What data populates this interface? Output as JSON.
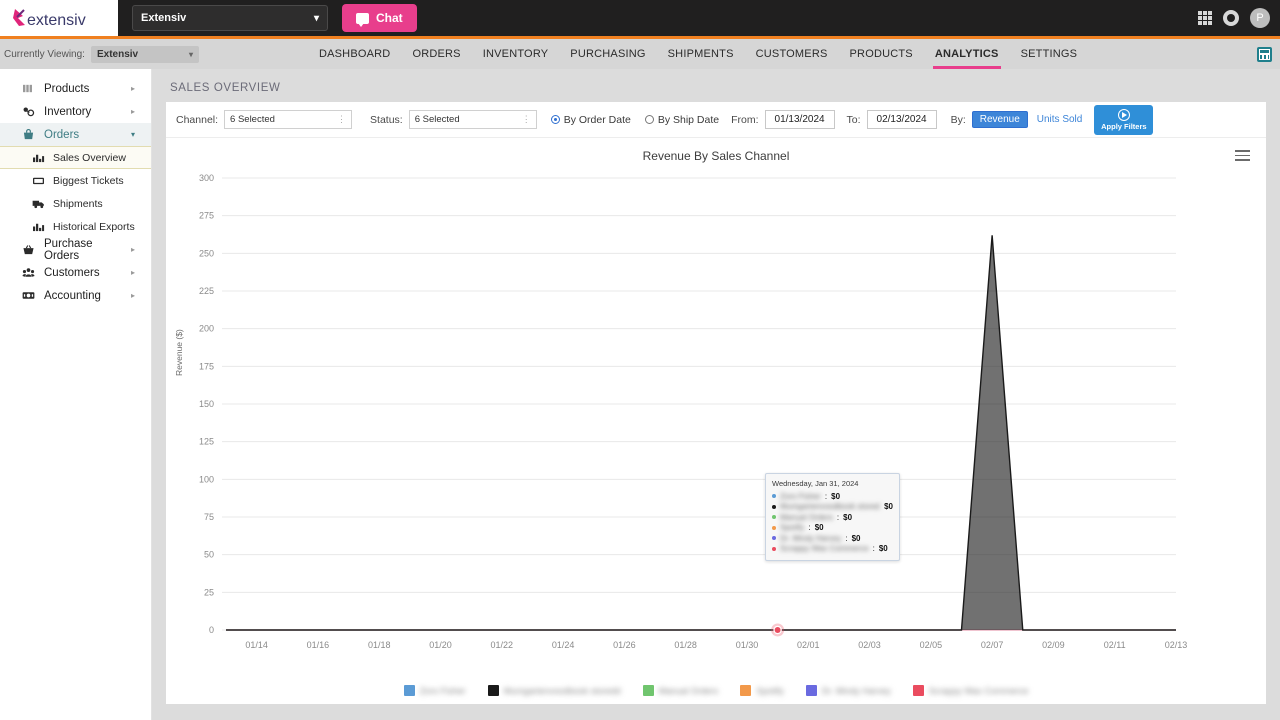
{
  "topbar": {
    "logo_text": "extensiv",
    "org_value": "Extensiv",
    "org_caret": "chevron-down",
    "chat_label": "Chat",
    "avatar_initial": "P"
  },
  "navbar": {
    "viewing_label": "Currently Viewing:",
    "viewing_value": "Extensiv",
    "tabs": [
      {
        "label": "DASHBOARD",
        "active": false
      },
      {
        "label": "ORDERS",
        "active": false
      },
      {
        "label": "INVENTORY",
        "active": false
      },
      {
        "label": "PURCHASING",
        "active": false
      },
      {
        "label": "SHIPMENTS",
        "active": false
      },
      {
        "label": "CUSTOMERS",
        "active": false
      },
      {
        "label": "PRODUCTS",
        "active": false
      },
      {
        "label": "ANALYTICS",
        "active": true
      },
      {
        "label": "SETTINGS",
        "active": false
      }
    ],
    "accent_color": "#e83e8c",
    "rule_color": "#f08020"
  },
  "sidebar": {
    "items": [
      {
        "label": "Products",
        "icon": "products-icon",
        "expandable": true,
        "open": false
      },
      {
        "label": "Inventory",
        "icon": "inventory-icon",
        "expandable": true,
        "open": false
      },
      {
        "label": "Orders",
        "icon": "orders-icon",
        "expandable": true,
        "open": true
      },
      {
        "label": "Purchase Orders",
        "icon": "purchase-orders-icon",
        "expandable": true,
        "open": false
      },
      {
        "label": "Customers",
        "icon": "customers-icon",
        "expandable": true,
        "open": false
      },
      {
        "label": "Accounting",
        "icon": "accounting-icon",
        "expandable": true,
        "open": false
      }
    ],
    "orders_children": [
      {
        "label": "Sales Overview",
        "icon": "chart-icon",
        "selected": true
      },
      {
        "label": "Biggest Tickets",
        "icon": "ticket-icon",
        "selected": false
      },
      {
        "label": "Shipments",
        "icon": "truck-icon",
        "selected": false
      },
      {
        "label": "Historical Exports",
        "icon": "chart-icon",
        "selected": false
      }
    ]
  },
  "page": {
    "title": "SALES OVERVIEW"
  },
  "filters": {
    "channel_label": "Channel:",
    "channel_value": "6 Selected",
    "status_label": "Status:",
    "status_value": "6 Selected",
    "by_order_date_label": "By Order Date",
    "by_ship_date_label": "By Ship Date",
    "date_mode": "order",
    "from_label": "From:",
    "from_value": "01/13/2024",
    "to_label": "To:",
    "to_value": "02/13/2024",
    "by_label": "By:",
    "revenue_label": "Revenue",
    "units_sold_label": "Units Sold",
    "metric_selected": "Revenue",
    "apply_label": "Apply Filters"
  },
  "tooltip": {
    "date": "Wednesday, Jan 31, 2024",
    "rows": [
      {
        "name": "Zoro Fisher",
        "value": "$0",
        "color": "#5b9bd5",
        "wide": false
      },
      {
        "name": "Mumgartenvoodbook storedd",
        "value": "$0",
        "color": "#1a1a1a",
        "wide": true
      },
      {
        "name": "Manual Orders",
        "value": "$0",
        "color": "#70c56e",
        "wide": false
      },
      {
        "name": "Spotify",
        "value": "$0",
        "color": "#f2994a",
        "wide": false
      },
      {
        "name": "Dr. Mindy Harvey",
        "value": "$0",
        "color": "#6a6ae0",
        "wide": false
      },
      {
        "name": "Scrappy Wax Commerce",
        "value": "$0",
        "color": "#ea4c5f",
        "wide": false
      }
    ]
  },
  "chart_data": {
    "type": "area",
    "title": "Revenue By Sales Channel",
    "xlabel": "",
    "ylabel": "Revenue ($)",
    "ylim": [
      0,
      300
    ],
    "ytick_step": 25,
    "yticks": [
      0,
      25,
      50,
      75,
      100,
      125,
      150,
      175,
      200,
      225,
      250,
      275,
      300
    ],
    "grid": true,
    "legend_position": "bottom",
    "xticks": [
      "01/14",
      "01/16",
      "01/18",
      "01/20",
      "01/22",
      "01/24",
      "01/26",
      "01/28",
      "01/30",
      "02/01",
      "02/03",
      "02/05",
      "02/07",
      "02/09",
      "02/11",
      "02/13"
    ],
    "x": [
      "01/13",
      "01/14",
      "01/15",
      "01/16",
      "01/17",
      "01/18",
      "01/19",
      "01/20",
      "01/21",
      "01/22",
      "01/23",
      "01/24",
      "01/25",
      "01/26",
      "01/27",
      "01/28",
      "01/29",
      "01/30",
      "01/31",
      "02/01",
      "02/02",
      "02/03",
      "02/04",
      "02/05",
      "02/06",
      "02/07",
      "02/08",
      "02/09",
      "02/10",
      "02/11",
      "02/12",
      "02/13"
    ],
    "series": [
      {
        "name": "Zoro Fisher",
        "color": "#5b9bd5",
        "values": [
          0,
          0,
          0,
          0,
          0,
          0,
          0,
          0,
          0,
          0,
          0,
          0,
          0,
          0,
          0,
          0,
          0,
          0,
          0,
          0,
          0,
          0,
          0,
          0,
          0,
          0,
          0,
          0,
          0,
          0,
          0,
          0
        ]
      },
      {
        "name": "Mumgartenvoodbook storedd",
        "color": "#1a1a1a",
        "values": [
          0,
          0,
          0,
          0,
          0,
          0,
          0,
          0,
          0,
          0,
          0,
          0,
          0,
          0,
          0,
          0,
          0,
          0,
          0,
          0,
          0,
          0,
          0,
          0,
          0,
          262,
          0,
          0,
          0,
          0,
          0,
          0
        ]
      },
      {
        "name": "Manual Orders",
        "color": "#70c56e",
        "values": [
          0,
          0,
          0,
          0,
          0,
          0,
          0,
          0,
          0,
          0,
          0,
          0,
          0,
          0,
          0,
          0,
          0,
          0,
          0,
          0,
          0,
          0,
          0,
          0,
          0,
          0,
          0,
          0,
          0,
          0,
          0,
          0
        ]
      },
      {
        "name": "Spotify",
        "color": "#f2994a",
        "values": [
          0,
          0,
          0,
          0,
          0,
          0,
          0,
          0,
          0,
          0,
          0,
          0,
          0,
          0,
          0,
          0,
          0,
          0,
          0,
          0,
          0,
          0,
          0,
          0,
          0,
          0,
          0,
          0,
          0,
          0,
          0,
          0
        ]
      },
      {
        "name": "Dr. Mindy Harvey",
        "color": "#6a6ae0",
        "values": [
          0,
          0,
          0,
          0,
          0,
          0,
          0,
          0,
          0,
          0,
          0,
          0,
          0,
          0,
          0,
          0,
          0,
          0,
          0,
          0,
          0,
          0,
          0,
          0,
          0,
          0,
          0,
          0,
          0,
          0,
          0,
          0
        ]
      },
      {
        "name": "Scrappy Wax Commerce",
        "color": "#ea4c5f",
        "values": [
          0,
          0,
          0,
          0,
          0,
          0,
          0,
          0,
          0,
          0,
          0,
          0,
          0,
          0,
          0,
          0,
          0,
          0,
          0,
          0,
          0,
          0,
          0,
          0,
          0,
          0,
          0,
          0,
          0,
          0,
          0,
          0
        ]
      }
    ],
    "hover_point": {
      "x": "01/31",
      "y": 0,
      "color": "#ea4c5f"
    },
    "peak": {
      "x": "02/07",
      "y": 262,
      "series": "Mumgartenvoodbook storedd"
    }
  },
  "legend": [
    {
      "label": "Zoro Fisher",
      "color": "#5b9bd5"
    },
    {
      "label": "Mumgartenvoodbook storedd",
      "color": "#1a1a1a"
    },
    {
      "label": "Manual Orders",
      "color": "#70c56e"
    },
    {
      "label": "Spotify",
      "color": "#f2994a"
    },
    {
      "label": "Dr. Mindy Harvey",
      "color": "#6a6ae0"
    },
    {
      "label": "Scrappy Wax Commerce",
      "color": "#ea4c5f"
    }
  ]
}
